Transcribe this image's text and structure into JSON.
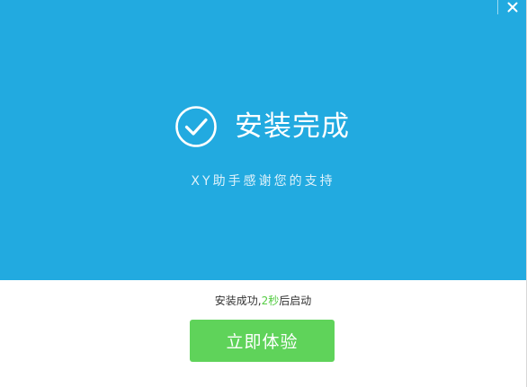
{
  "window": {
    "close_label": "×"
  },
  "hero": {
    "title": "安装完成",
    "subtitle": "XY助手感谢您的支持",
    "icon": "check-circle-icon"
  },
  "status": {
    "prefix": "安装成功,",
    "seconds": "2秒",
    "suffix": "后启动"
  },
  "actions": {
    "start_label": "立即体验"
  },
  "colors": {
    "hero_background": "#22aae0",
    "button_green": "#5fd35a",
    "countdown_green": "#55cc44"
  }
}
